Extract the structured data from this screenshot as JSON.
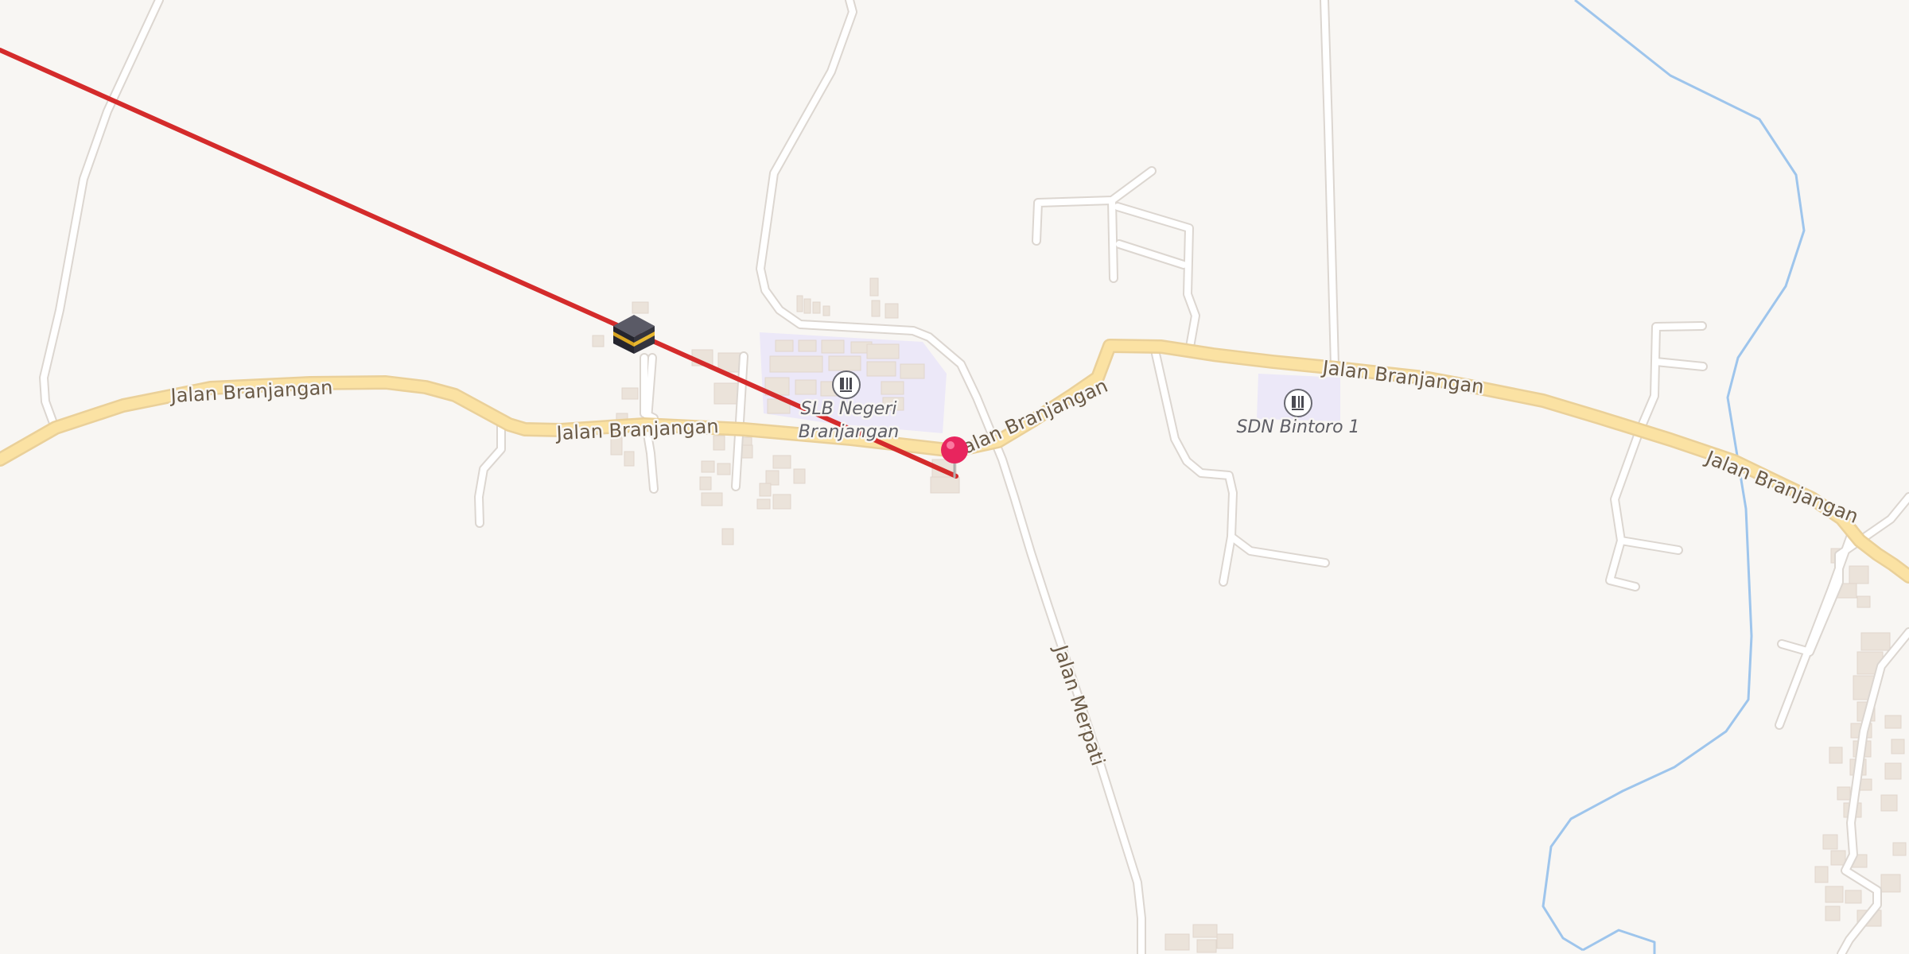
{
  "map": {
    "roads": [
      {
        "name": "Jalan Branjangan",
        "kind": "primary"
      },
      {
        "name": "Jalan Merpati",
        "kind": "residential"
      }
    ],
    "road_labels": [
      "Jalan Branjangan",
      "Jalan Branjangan",
      "Jalan Branjangan",
      "Jalan Branjangan",
      "Jalan Branjangan",
      "Jalan Merpati"
    ],
    "pois": [
      {
        "name_line1": "SLB Negeri",
        "name_line2": "Branjangan",
        "icon": "school-icon"
      },
      {
        "name": "SDN Bintoro 1",
        "icon": "school-icon"
      }
    ],
    "markers": {
      "location": {
        "icon": "location-pin-icon",
        "color": "#e8255e"
      },
      "qibla": {
        "icon": "kaaba-icon",
        "line_color": "#d42b2b"
      }
    },
    "colors": {
      "background": "#f8f6f3",
      "primary_road": "#fbe2a3",
      "primary_road_casing": "#ead099",
      "minor_road": "#ffffff",
      "minor_road_casing": "#dcd6d0",
      "water": "#9ec5ec",
      "school_area": "#ece8f8",
      "building": "#ece4dc"
    }
  }
}
